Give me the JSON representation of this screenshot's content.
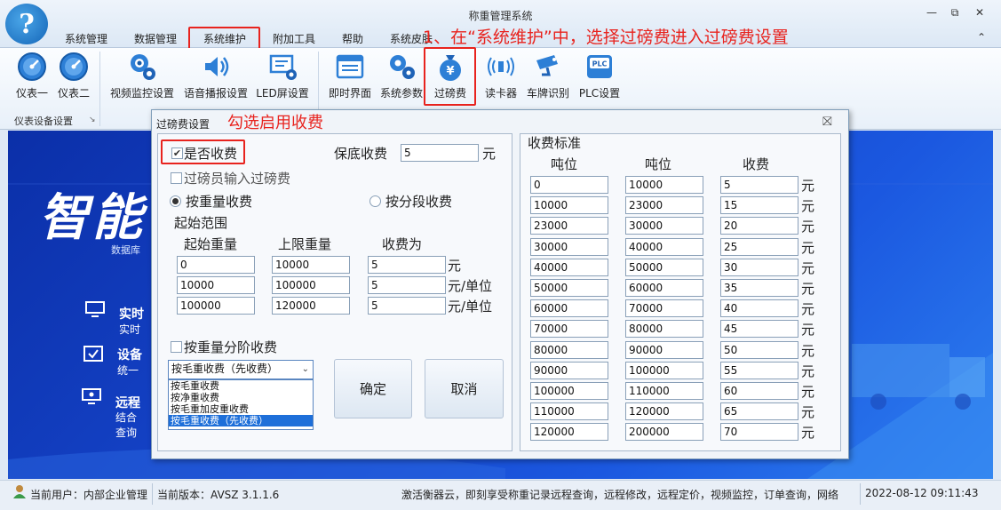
{
  "window": {
    "title": "称重管理系统",
    "min": "—",
    "max": "⧉",
    "close": "✕",
    "collapse": "⌃"
  },
  "tabs": [
    "系统管理",
    "数据管理",
    "系统维护",
    "附加工具",
    "帮助",
    "系统皮肤"
  ],
  "annotations": {
    "step1": "1、在“系统维护”中，选择过磅费进入过磅费设置",
    "step2": "勾选启用收费"
  },
  "ribbon": {
    "group_label": "仪表设备设置",
    "buttons": [
      "仪表一",
      "仪表二",
      "视频监控设置",
      "语音播报设置",
      "LED屏设置",
      "即时界面",
      "系统参数",
      "过磅费",
      "读卡器",
      "车牌识别",
      "PLC设置"
    ],
    "plc_text": "PLC",
    "fee_symbol": "¥"
  },
  "background": {
    "big_title": "智能",
    "db_text": "数据库",
    "items": [
      {
        "title": "实时",
        "sub": "实时"
      },
      {
        "title": "设备",
        "sub": "统一"
      },
      {
        "title": "远程",
        "sub": "结合",
        "sub2": "查询"
      }
    ]
  },
  "dialog": {
    "title": "过磅费设置",
    "close": "⛝",
    "enable_fee": {
      "label": "是否收费",
      "checked": true
    },
    "operator_input": {
      "label": "过磅员输入过磅费",
      "checked": false
    },
    "min_fee": {
      "label": "保底收费",
      "value": "5",
      "unit": "元"
    },
    "mode_weight": {
      "label": "按重量收费",
      "selected": true
    },
    "mode_segment": {
      "label": "按分段收费",
      "selected": false
    },
    "range_heading": "起始范围",
    "range_headers": [
      "起始重量",
      "上限重量",
      "收费为"
    ],
    "ranges": [
      {
        "start": "0",
        "limit": "10000",
        "fee": "5",
        "unit": "元"
      },
      {
        "start": "10000",
        "limit": "100000",
        "fee": "5",
        "unit": "元/单位"
      },
      {
        "start": "100000",
        "limit": "120000",
        "fee": "5",
        "unit": "元/单位"
      }
    ],
    "tiered": {
      "label": "按重量分阶收费",
      "checked": false
    },
    "dropdown": {
      "selected": "按毛重收费（先收费）",
      "options": [
        "按毛重收费",
        "按净重收费",
        "按毛重加皮重收费",
        "按毛重收费（先收费）"
      ]
    },
    "confirm": "确定",
    "cancel": "取消",
    "standard": {
      "heading": "收费标准",
      "headers": [
        "吨位",
        "吨位",
        "收费"
      ],
      "unit": "元",
      "rows": [
        [
          "0",
          "10000",
          "5"
        ],
        [
          "10000",
          "23000",
          "15"
        ],
        [
          "23000",
          "30000",
          "20"
        ],
        [
          "30000",
          "40000",
          "25"
        ],
        [
          "40000",
          "50000",
          "30"
        ],
        [
          "50000",
          "60000",
          "35"
        ],
        [
          "60000",
          "70000",
          "40"
        ],
        [
          "70000",
          "80000",
          "45"
        ],
        [
          "80000",
          "90000",
          "50"
        ],
        [
          "90000",
          "100000",
          "55"
        ],
        [
          "100000",
          "110000",
          "60"
        ],
        [
          "110000",
          "120000",
          "65"
        ],
        [
          "120000",
          "200000",
          "70"
        ]
      ]
    }
  },
  "statusbar": {
    "user": "当前用户：内部企业管理",
    "version": "当前版本：AVSZ 3.1.1.6",
    "message": "激活衡器云，即刻享受称重记录远程查询，远程修改，远程定价，视频监控，订单查询，网络",
    "datetime": "2022-08-12 09:11:43"
  },
  "colors": {
    "accent_red": "#e8231e",
    "ribbon_blue": "#1e6fd9",
    "bg_blue": "#1646cc"
  }
}
